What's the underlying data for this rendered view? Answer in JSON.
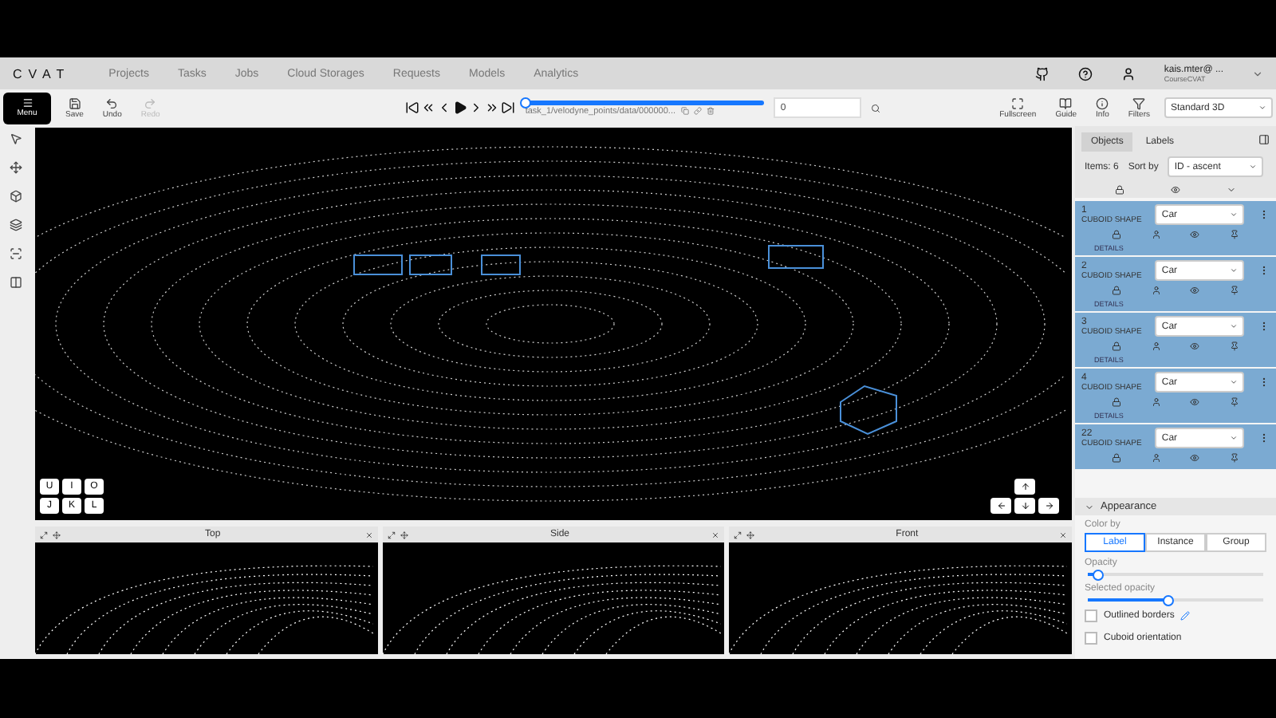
{
  "nav": {
    "logo": "CVAT",
    "items": [
      "Projects",
      "Tasks",
      "Jobs",
      "Cloud Storages",
      "Requests",
      "Models",
      "Analytics"
    ],
    "user": "kais.mter@ ...",
    "organization": "CourseCVAT"
  },
  "toolbar": {
    "menu": "Menu",
    "actions": [
      {
        "label": "Save",
        "disabled": false
      },
      {
        "label": "Undo",
        "disabled": false
      },
      {
        "label": "Redo",
        "disabled": true
      }
    ],
    "frame_path": "task_1/velodyne_points/data/000000...",
    "frame": "0",
    "level": 0,
    "tools": [
      "Fullscreen",
      "Guide",
      "Info",
      "Filters"
    ],
    "workspace": "Standard 3D"
  },
  "canvas": {
    "keys": [
      "U",
      "I",
      "O",
      "J",
      "K",
      "L"
    ]
  },
  "views": [
    "Top",
    "Side",
    "Front"
  ],
  "sidebar": {
    "tabs": [
      {
        "label": "Objects",
        "selected": true
      },
      {
        "label": "Labels",
        "selected": false
      }
    ],
    "items_count": "Items: 6",
    "sort_label": "Sort by",
    "sort_value": "ID - ascent",
    "objects": [
      {
        "id": "1",
        "type": "CUBOID SHAPE",
        "label": "Car",
        "details": "DETAILS"
      },
      {
        "id": "2",
        "type": "CUBOID SHAPE",
        "label": "Car",
        "details": "DETAILS"
      },
      {
        "id": "3",
        "type": "CUBOID SHAPE",
        "label": "Car",
        "details": "DETAILS"
      },
      {
        "id": "4",
        "type": "CUBOID SHAPE",
        "label": "Car",
        "details": "DETAILS"
      },
      {
        "id": "22",
        "type": "CUBOID SHAPE",
        "label": "Car"
      }
    ]
  },
  "appearance": {
    "title": "Appearance",
    "color_by_label": "Color by",
    "color_by": [
      {
        "label": "Label",
        "selected": true
      },
      {
        "label": "Instance",
        "selected": false
      },
      {
        "label": "Group",
        "selected": false
      }
    ],
    "sliders": [
      {
        "label": "Opacity",
        "level": 0.05
      },
      {
        "label": "Selected opacity",
        "level": 0.45
      }
    ],
    "checkboxes": [
      {
        "label": "Outlined borders",
        "checked": false
      },
      {
        "label": "Cuboid orientation",
        "checked": false
      }
    ]
  }
}
